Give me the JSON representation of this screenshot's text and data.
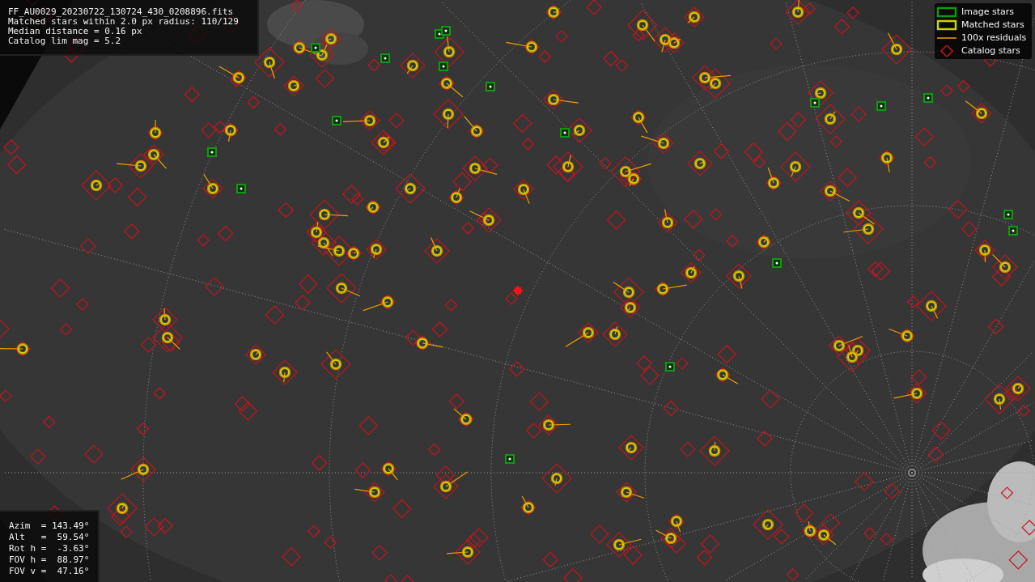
{
  "info_panel": {
    "lines": [
      "FF_AU0029_20230722_130724_430_0208896.fits",
      "Matched stars within 2.0 px radius: 110/129",
      "Median distance = 0.16 px",
      "Catalog lim mag = 5.2"
    ]
  },
  "legend": {
    "items": [
      {
        "label": "Image stars"
      },
      {
        "kind": "matched",
        "label": "Matched stars"
      },
      {
        "kind": "residual",
        "label": "100x residuals"
      },
      {
        "kind": "catalog",
        "label": "Catalog stars"
      }
    ]
  },
  "pointing_panel": {
    "lines": [
      "Azim  = 143.49°",
      "Alt   =  59.54°",
      "Rot h =  -3.63°",
      "FOV h =  88.97°",
      "FOV v =  47.16°"
    ]
  }
}
